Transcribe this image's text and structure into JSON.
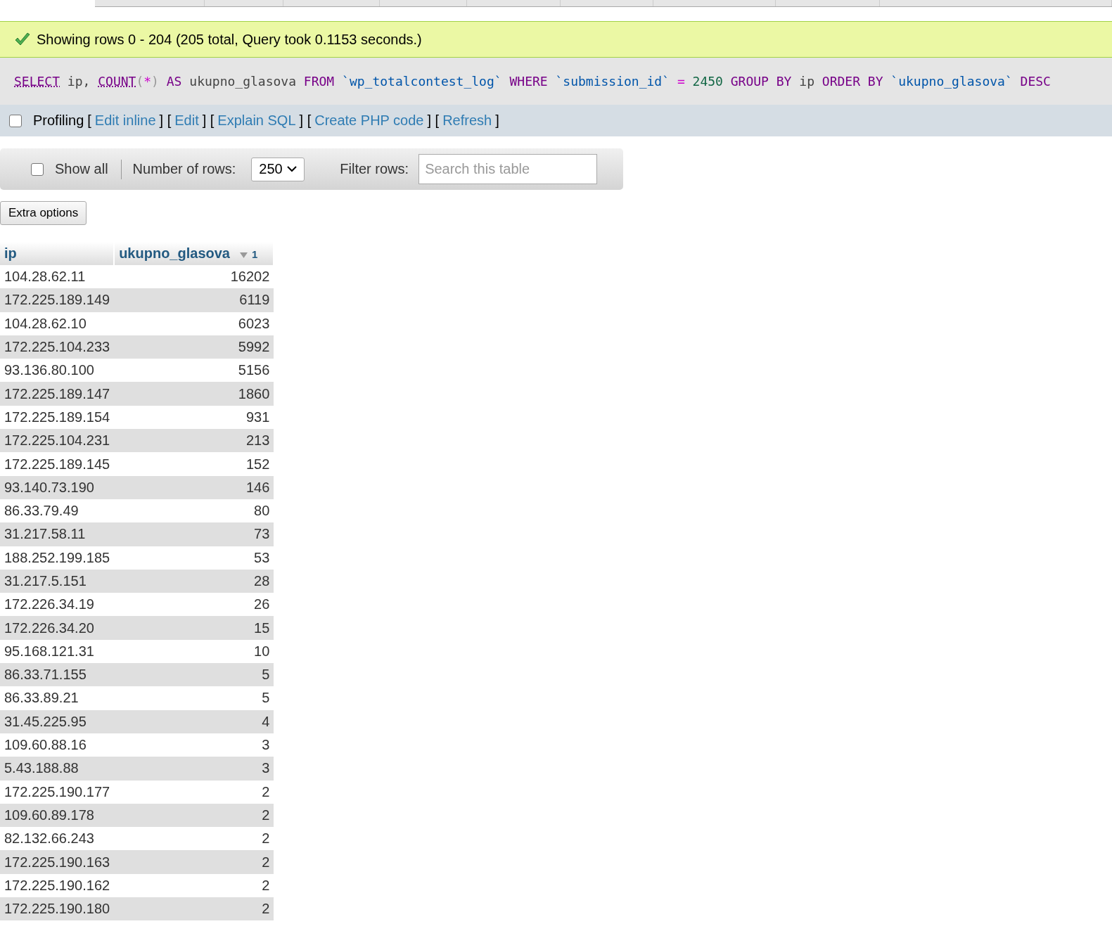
{
  "message": {
    "kind": "success",
    "text": "Showing rows 0 - 204 (205 total, Query took 0.1153 seconds.)"
  },
  "sql": [
    {
      "kind": "link",
      "text": "SELECT"
    },
    {
      "kind": "plain",
      "text": " ip, "
    },
    {
      "kind": "link",
      "text": "COUNT"
    },
    {
      "kind": "punct",
      "text": "("
    },
    {
      "kind": "op",
      "text": "*"
    },
    {
      "kind": "punct",
      "text": ")"
    },
    {
      "kind": "keyword",
      "text": " AS "
    },
    {
      "kind": "plain",
      "text": "ukupno_glasova "
    },
    {
      "kind": "keyword",
      "text": "FROM "
    },
    {
      "kind": "ident",
      "text": "`wp_totalcontest_log`"
    },
    {
      "kind": "keyword",
      "text": " WHERE "
    },
    {
      "kind": "ident",
      "text": "`submission_id`"
    },
    {
      "kind": "op",
      "text": " = "
    },
    {
      "kind": "number",
      "text": "2450"
    },
    {
      "kind": "keyword",
      "text": " GROUP BY "
    },
    {
      "kind": "plain",
      "text": "ip "
    },
    {
      "kind": "keyword",
      "text": "ORDER BY "
    },
    {
      "kind": "ident",
      "text": "`ukupno_glasova`"
    },
    {
      "kind": "keyword",
      "text": " DESC"
    }
  ],
  "profiling": {
    "label": "Profiling",
    "checked": false,
    "links": [
      "Edit inline",
      "Edit",
      "Explain SQL",
      "Create PHP code",
      "Refresh"
    ],
    "brackets": [
      "[",
      "] [",
      "] [",
      "] [",
      "] [",
      "]"
    ]
  },
  "toolbar": {
    "show_all": {
      "label": "Show all",
      "checked": false
    },
    "rows_label": "Number of rows:",
    "rows_value": "250",
    "filter_label": "Filter rows:",
    "filter_placeholder": "Search this table"
  },
  "extra_options": "Extra options",
  "table": {
    "columns": [
      {
        "label": "ip",
        "sorted": false
      },
      {
        "label": "ukupno_glasova",
        "sorted": true,
        "sort_index": "1"
      }
    ],
    "rows": [
      [
        "104.28.62.11",
        "16202"
      ],
      [
        "172.225.189.149",
        "6119"
      ],
      [
        "104.28.62.10",
        "6023"
      ],
      [
        "172.225.104.233",
        "5992"
      ],
      [
        "93.136.80.100",
        "5156"
      ],
      [
        "172.225.189.147",
        "1860"
      ],
      [
        "172.225.189.154",
        "931"
      ],
      [
        "172.225.104.231",
        "213"
      ],
      [
        "172.225.189.145",
        "152"
      ],
      [
        "93.140.73.190",
        "146"
      ],
      [
        "86.33.79.49",
        "80"
      ],
      [
        "31.217.58.11",
        "73"
      ],
      [
        "188.252.199.185",
        "53"
      ],
      [
        "31.217.5.151",
        "28"
      ],
      [
        "172.226.34.19",
        "26"
      ],
      [
        "172.226.34.20",
        "15"
      ],
      [
        "95.168.121.31",
        "10"
      ],
      [
        "86.33.71.155",
        "5"
      ],
      [
        "86.33.89.21",
        "5"
      ],
      [
        "31.45.225.95",
        "4"
      ],
      [
        "109.60.88.16",
        "3"
      ],
      [
        "5.43.188.88",
        "3"
      ],
      [
        "172.225.190.177",
        "2"
      ],
      [
        "109.60.89.178",
        "2"
      ],
      [
        "82.132.66.243",
        "2"
      ],
      [
        "172.225.190.163",
        "2"
      ],
      [
        "172.225.190.162",
        "2"
      ],
      [
        "172.225.190.180",
        "2"
      ]
    ]
  }
}
